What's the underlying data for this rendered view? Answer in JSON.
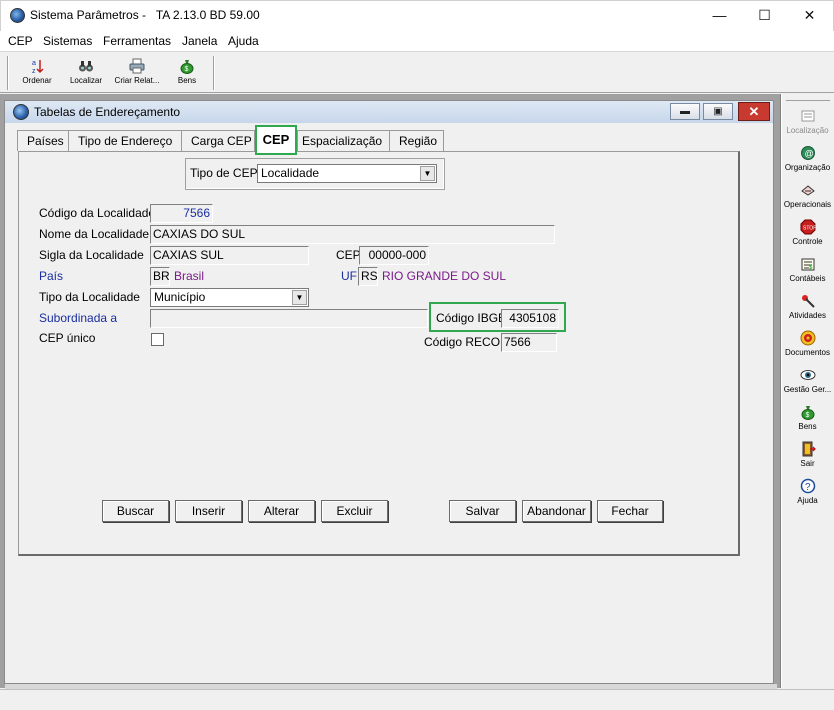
{
  "window": {
    "title": "Sistema Parâmetros -   TA 2.13.0 BD 59.00",
    "minimize": "—",
    "maximize": "☐",
    "close": "✕"
  },
  "menu": [
    "CEP",
    "Sistemas",
    "Ferramentas",
    "Janela",
    "Ajuda"
  ],
  "toolbar": [
    {
      "label": "Ordenar",
      "icon": "sort-az-icon"
    },
    {
      "label": "Localizar",
      "icon": "binoculars-icon"
    },
    {
      "label": "Criar Relat...",
      "icon": "printer-icon"
    },
    {
      "label": "Bens",
      "icon": "money-bag-icon"
    }
  ],
  "child": {
    "title": "Tabelas de Endereçamento",
    "min": "▬",
    "restore": "▣",
    "close": "✕"
  },
  "tabs": [
    "Países",
    "Tipo de Endereço",
    "Carga CEP",
    "CEP",
    "Espacialização",
    "Região"
  ],
  "form": {
    "tipo_cep_label": "Tipo de CEP",
    "tipo_cep_value": "Localidade",
    "codigo_localidade_label": "Código da Localidade",
    "codigo_localidade_value": "7566",
    "nome_localidade_label": "Nome da Localidade",
    "nome_localidade_value": "CAXIAS DO SUL",
    "sigla_localidade_label": "Sigla da Localidade",
    "sigla_localidade_value": "CAXIAS SUL",
    "cep_label": "CEP",
    "cep_value": "00000-000",
    "pais_label": "País",
    "pais_code": "BR",
    "pais_name": "Brasil",
    "uf_label": "UF",
    "uf_code": "RS",
    "uf_name": "RIO GRANDE DO SUL",
    "tipo_localidade_label": "Tipo da Localidade",
    "tipo_localidade_value": "Município",
    "subordinada_label": "Subordinada a",
    "subordinada_value": "",
    "codigo_ibge_label": "Código IBGE",
    "codigo_ibge_value": "4305108",
    "cep_unico_label": "CEP único",
    "codigo_recor_label": "Código RECOR",
    "codigo_recor_value": "7566"
  },
  "buttons": {
    "buscar": "Buscar",
    "inserir": "Inserir",
    "alterar": "Alterar",
    "excluir": "Excluir",
    "salvar": "Salvar",
    "abandonar": "Abandonar",
    "fechar": "Fechar"
  },
  "rightbar": [
    {
      "label": "Localização",
      "icon": "localizacao-icon"
    },
    {
      "label": "Organização",
      "icon": "organizacao-icon"
    },
    {
      "label": "Operacionais",
      "icon": "operacionais-icon"
    },
    {
      "label": "Controle",
      "icon": "stop-sign-icon"
    },
    {
      "label": "Contábeis",
      "icon": "contabeis-icon"
    },
    {
      "label": "Atividades",
      "icon": "atividades-icon"
    },
    {
      "label": "Documentos",
      "icon": "documentos-icon"
    },
    {
      "label": "Gestão Ger...",
      "icon": "eye-icon"
    },
    {
      "label": "Bens",
      "icon": "money-bag-icon"
    },
    {
      "label": "Sair",
      "icon": "exit-door-icon"
    },
    {
      "label": "Ajuda",
      "icon": "help-icon"
    }
  ],
  "colors": {
    "highlight": "#2fa84f",
    "link_blue": "#1a2ea0",
    "value_purple": "#7a1a8a"
  }
}
